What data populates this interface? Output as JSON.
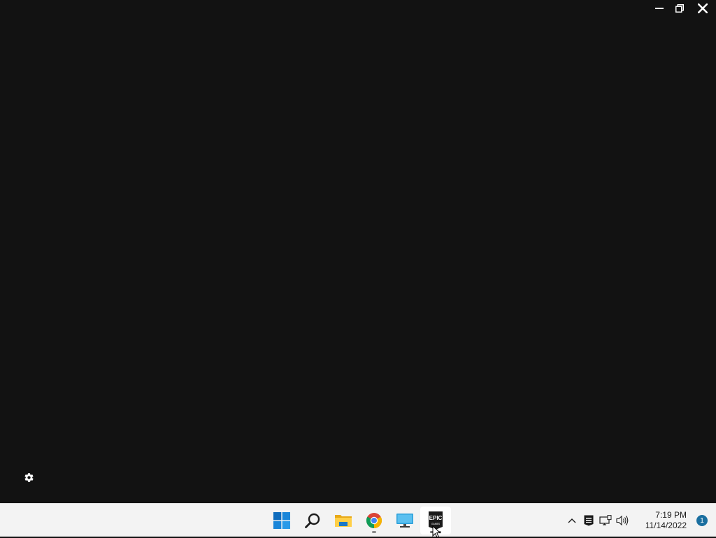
{
  "window": {
    "controls": [
      {
        "name": "minimize",
        "icon": "minimize-icon"
      },
      {
        "name": "restore",
        "icon": "restore-icon"
      },
      {
        "name": "close",
        "icon": "close-icon"
      }
    ]
  },
  "app": {
    "settings_icon": "gear-icon"
  },
  "taskbar": {
    "apps": [
      {
        "name": "start",
        "icon": "windows-logo-icon",
        "running": false
      },
      {
        "name": "search",
        "icon": "search-icon",
        "running": false
      },
      {
        "name": "file-explorer",
        "icon": "folder-icon",
        "running": false
      },
      {
        "name": "chrome",
        "icon": "chrome-icon",
        "running": true
      },
      {
        "name": "remote-desktop",
        "icon": "monitor-icon",
        "running": false
      },
      {
        "name": "epic-games-launcher",
        "icon": "epic-games-icon",
        "running": true,
        "active": true
      }
    ],
    "epic_logo_text": "EPIC",
    "epic_logo_subtext": "GAMES",
    "tray": {
      "icons": [
        "chevron-up-icon",
        "epic-games-tray-icon",
        "network-icon",
        "volume-icon"
      ],
      "time": "7:19 PM",
      "date": "11/14/2022",
      "notification_count": "1"
    }
  },
  "colors": {
    "app_background": "#121212",
    "taskbar_background": "#f3f3f3",
    "badge": "#1a6fa0"
  }
}
